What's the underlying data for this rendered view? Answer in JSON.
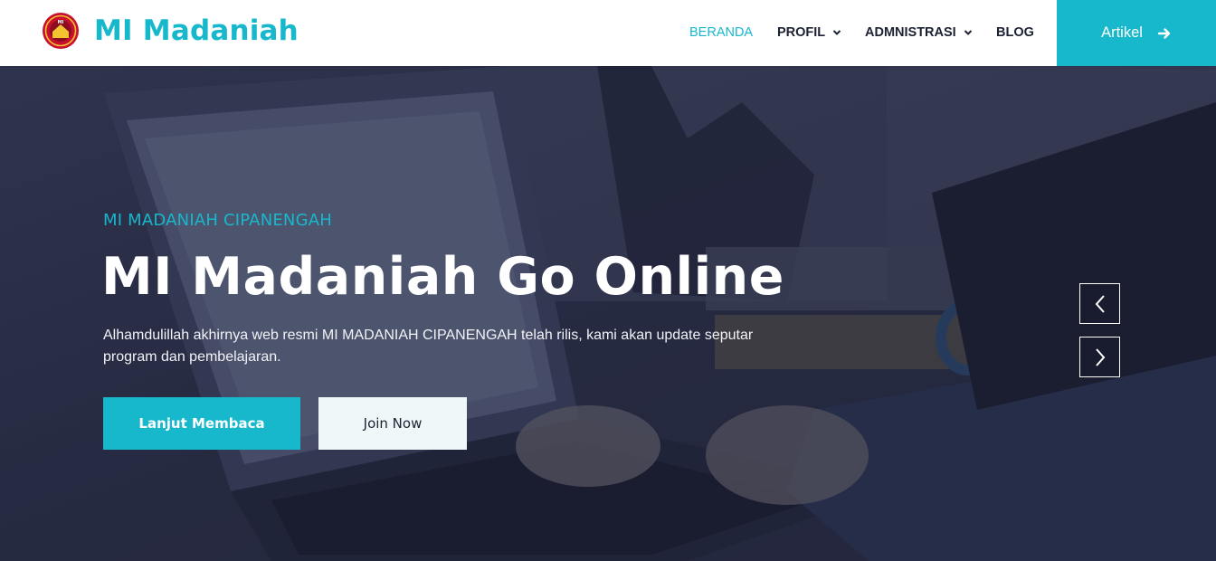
{
  "header": {
    "brand_name": "MI Madaniah",
    "logo_text": "MI",
    "nav": [
      {
        "label": "BERANDA",
        "active": true,
        "has_dropdown": false
      },
      {
        "label": "PROFIL",
        "active": false,
        "has_dropdown": true
      },
      {
        "label": "ADMNISTRASI",
        "active": false,
        "has_dropdown": true
      },
      {
        "label": "BLOG",
        "active": false,
        "has_dropdown": false
      }
    ],
    "cta_label": "Artikel",
    "cta_icon": "arrow-right-icon"
  },
  "hero": {
    "subtitle": "MI MADANIAH CIPANENGAH",
    "title": "MI Madaniah Go Online",
    "description": "Alhamdulillah akhirnya web resmi MI MADANIAH CIPANENGAH telah rilis, kami akan update seputar program dan pembelajaran.",
    "primary_button": "Lanjut Membaca",
    "secondary_button": "Join Now",
    "prev_icon": "chevron-left-icon",
    "next_icon": "chevron-right-icon"
  },
  "colors": {
    "accent": "#17b8cc",
    "nav_text": "#1d2233",
    "hero_overlay": "#2c3147"
  }
}
